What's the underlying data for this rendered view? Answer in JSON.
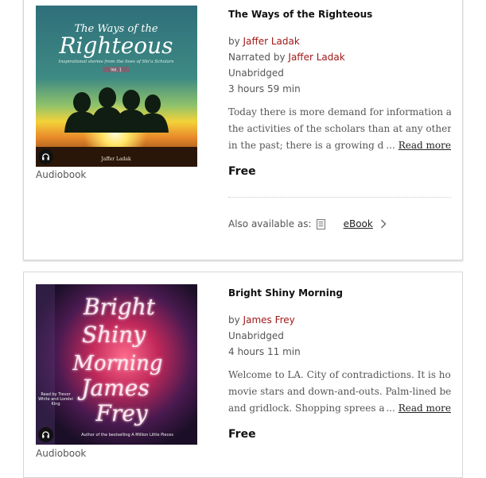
{
  "results": [
    {
      "title": "The Ways of the Righteous",
      "by_prefix": "by",
      "author": "Jaffer Ladak",
      "narrated_prefix": "Narrated by",
      "narrator": "Jaffer Ladak",
      "edition": "Unabridged",
      "duration": "3 hours 59 min",
      "description_lines": [
        "Today there is more demand for information about",
        "the activities of the scholars than at any other time",
        "in the past; there is a growing desire to"
      ],
      "read_more": "Read more",
      "ellipsis": "...",
      "price": "Free",
      "format_label": "Audiobook",
      "also_available_label": "Also available as:",
      "also_available_format": "eBook",
      "cover_text": {
        "line1": "The Ways of the",
        "line2": "Righteous",
        "subtitle": "Inspirational stories from the lives of Shi'a Scholars",
        "volume": "Vol. 1",
        "author": "Jaffer Ladak"
      }
    },
    {
      "title": "Bright Shiny Morning",
      "by_prefix": "by",
      "author": "James Frey",
      "edition": "Unabridged",
      "duration": "4 hours 11 min",
      "description_lines": [
        "Welcome to LA. City of contradictions. It is home to",
        "movie stars and down-and-outs. Palm-lined beaches",
        "and gridlock. Shopping sprees and gun"
      ],
      "read_more": "Read more",
      "ellipsis": "...",
      "price": "Free",
      "format_label": "Audiobook",
      "cover_text": {
        "neon": [
          "Bright",
          "Shiny",
          "Morning",
          "James",
          "Frey"
        ],
        "read_by": "Read by Trevor White and Lorelei King",
        "tagline": "Author of the bestselling A Million Little Pieces"
      }
    }
  ],
  "colors": {
    "link_red": "#a01818",
    "card_border": "#d6d6d6"
  }
}
